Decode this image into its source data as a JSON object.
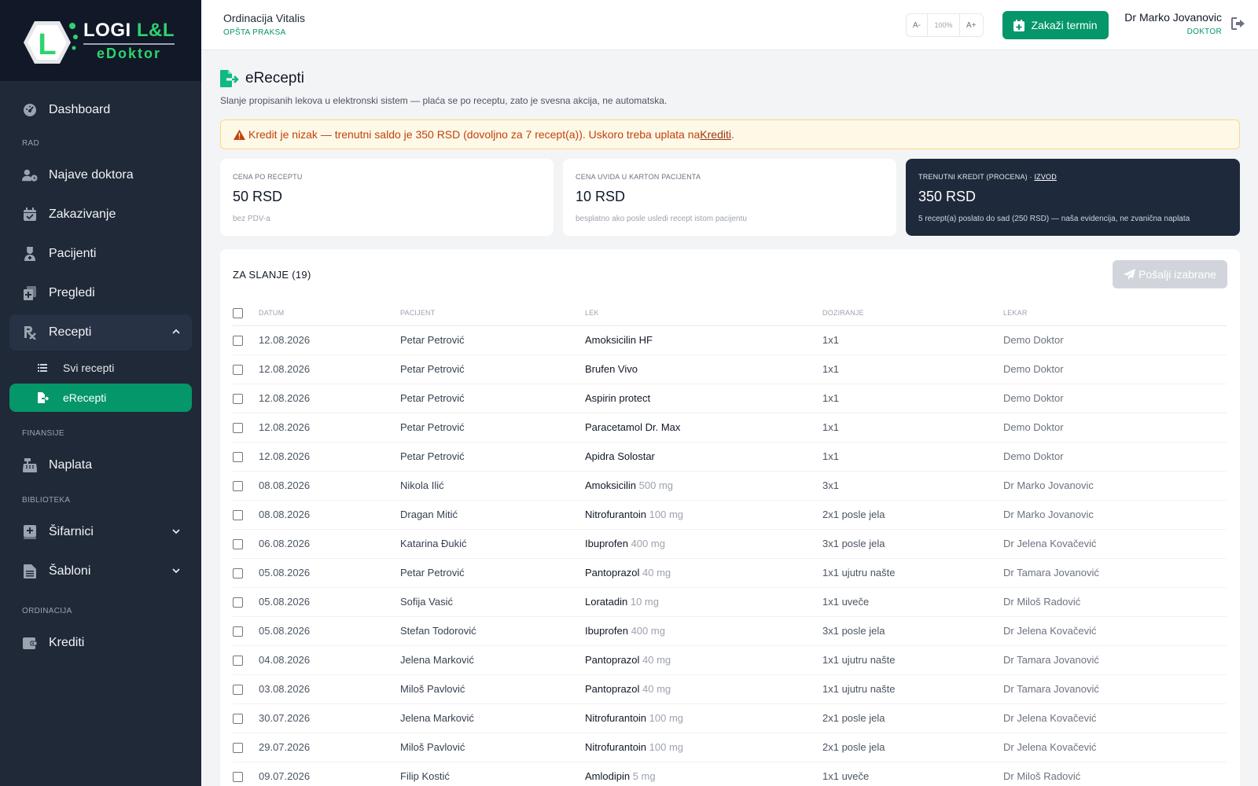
{
  "brand": {
    "name_main": "LOGI",
    "name_accent": "L&L",
    "name_sub": "eDoktor",
    "logo_letter": "L",
    "accent": "#2dd36f"
  },
  "sidebar": {
    "dashboard": "Dashboard",
    "section_rad": "RAD",
    "najave": "Najave doktora",
    "zakazivanje": "Zakazivanje",
    "pacijenti": "Pacijenti",
    "pregledi": "Pregledi",
    "recepti": "Recepti",
    "svi_recepti": "Svi recepti",
    "erecepti": "eRecepti",
    "section_finansije": "FINANSIJE",
    "naplata": "Naplata",
    "section_biblioteka": "BIBLIOTEKA",
    "sifarnici": "Šifarnici",
    "sabloni": "Šabloni",
    "section_ordinacija": "ORDINACIJA",
    "krediti": "Krediti"
  },
  "header": {
    "clinic_name": "Ordinacija Vitalis",
    "clinic_type": "OPŠTA PRAKSA",
    "font_minus": "A-",
    "font_zoom": "100%",
    "font_plus": "A+",
    "schedule_button": "Zakaži termin",
    "user_name": "Dr Marko Jovanovic",
    "user_role": "DOKTOR"
  },
  "page": {
    "title": "eRecepti",
    "description": "Slanje propisanih lekova u elektronski sistem — plaća se po receptu, zato je svesna akcija, ne automatska.",
    "alert_text": "Kredit je nizak — trenutni saldo je 350 RSD (dovoljno za 7 recept(a)). Uskoro treba uplata na ",
    "alert_link": "Krediti",
    "alert_end": "."
  },
  "cards": {
    "price": {
      "label": "CENA PO RECEPTU",
      "value": "50 RSD",
      "note": "bez PDV-a"
    },
    "view": {
      "label": "CENA UVIDA U KARTON PACIJENTA",
      "value": "10 RSD",
      "note": "besplatno ako posle usledi recept istom pacijentu"
    },
    "credit": {
      "label": "TRENUTNI KREDIT (PROCENA) · ",
      "link": "IZVOD",
      "value": "350 RSD",
      "note": "5 recept(a) poslato do sad (250 RSD) — naša evidencija, ne zvanična naplata"
    }
  },
  "table": {
    "title": "ZA SLANJE (19)",
    "send_button": "Pošalji izabrane",
    "headers": {
      "date": "DATUM",
      "patient": "PACIJENT",
      "drug": "LEK",
      "dose": "DOZIRANJE",
      "doctor": "LEKAR"
    },
    "rows": [
      {
        "date": "12.08.2026",
        "patient": "Petar Petrović",
        "drug": "Amoksicilin HF",
        "strength": "",
        "dose": "1x1",
        "doctor": "Demo Doktor"
      },
      {
        "date": "12.08.2026",
        "patient": "Petar Petrović",
        "drug": "Brufen Vivo",
        "strength": "",
        "dose": "1x1",
        "doctor": "Demo Doktor"
      },
      {
        "date": "12.08.2026",
        "patient": "Petar Petrović",
        "drug": "Aspirin protect",
        "strength": "",
        "dose": "1x1",
        "doctor": "Demo Doktor"
      },
      {
        "date": "12.08.2026",
        "patient": "Petar Petrović",
        "drug": "Paracetamol Dr. Max",
        "strength": "",
        "dose": "1x1",
        "doctor": "Demo Doktor"
      },
      {
        "date": "12.08.2026",
        "patient": "Petar Petrović",
        "drug": "Apidra Solostar",
        "strength": "",
        "dose": "1x1",
        "doctor": "Demo Doktor"
      },
      {
        "date": "08.08.2026",
        "patient": "Nikola Ilić",
        "drug": "Amoksicilin",
        "strength": "500 mg",
        "dose": "3x1",
        "doctor": "Dr Marko Jovanovic"
      },
      {
        "date": "08.08.2026",
        "patient": "Dragan Mitić",
        "drug": "Nitrofurantoin",
        "strength": "100 mg",
        "dose": "2x1 posle jela",
        "doctor": "Dr Marko Jovanovic"
      },
      {
        "date": "06.08.2026",
        "patient": "Katarina Đukić",
        "drug": "Ibuprofen",
        "strength": "400 mg",
        "dose": "3x1 posle jela",
        "doctor": "Dr Jelena Kovačević"
      },
      {
        "date": "05.08.2026",
        "patient": "Petar Petrović",
        "drug": "Pantoprazol",
        "strength": "40 mg",
        "dose": "1x1 ujutru našte",
        "doctor": "Dr Tamara Jovanović"
      },
      {
        "date": "05.08.2026",
        "patient": "Sofija Vasić",
        "drug": "Loratadin",
        "strength": "10 mg",
        "dose": "1x1 uveče",
        "doctor": "Dr Miloš Radović"
      },
      {
        "date": "05.08.2026",
        "patient": "Stefan Todorović",
        "drug": "Ibuprofen",
        "strength": "400 mg",
        "dose": "3x1 posle jela",
        "doctor": "Dr Jelena Kovačević"
      },
      {
        "date": "04.08.2026",
        "patient": "Jelena Marković",
        "drug": "Pantoprazol",
        "strength": "40 mg",
        "dose": "1x1 ujutru našte",
        "doctor": "Dr Tamara Jovanović"
      },
      {
        "date": "03.08.2026",
        "patient": "Miloš Pavlović",
        "drug": "Pantoprazol",
        "strength": "40 mg",
        "dose": "1x1 ujutru našte",
        "doctor": "Dr Tamara Jovanović"
      },
      {
        "date": "30.07.2026",
        "patient": "Jelena Marković",
        "drug": "Nitrofurantoin",
        "strength": "100 mg",
        "dose": "2x1 posle jela",
        "doctor": "Dr Jelena Kovačević"
      },
      {
        "date": "29.07.2026",
        "patient": "Miloš Pavlović",
        "drug": "Nitrofurantoin",
        "strength": "100 mg",
        "dose": "2x1 posle jela",
        "doctor": "Dr Jelena Kovačević"
      },
      {
        "date": "09.07.2026",
        "patient": "Filip Kostić",
        "drug": "Amlodipin",
        "strength": "5 mg",
        "dose": "1x1 uveče",
        "doctor": "Dr Miloš Radović"
      }
    ]
  }
}
